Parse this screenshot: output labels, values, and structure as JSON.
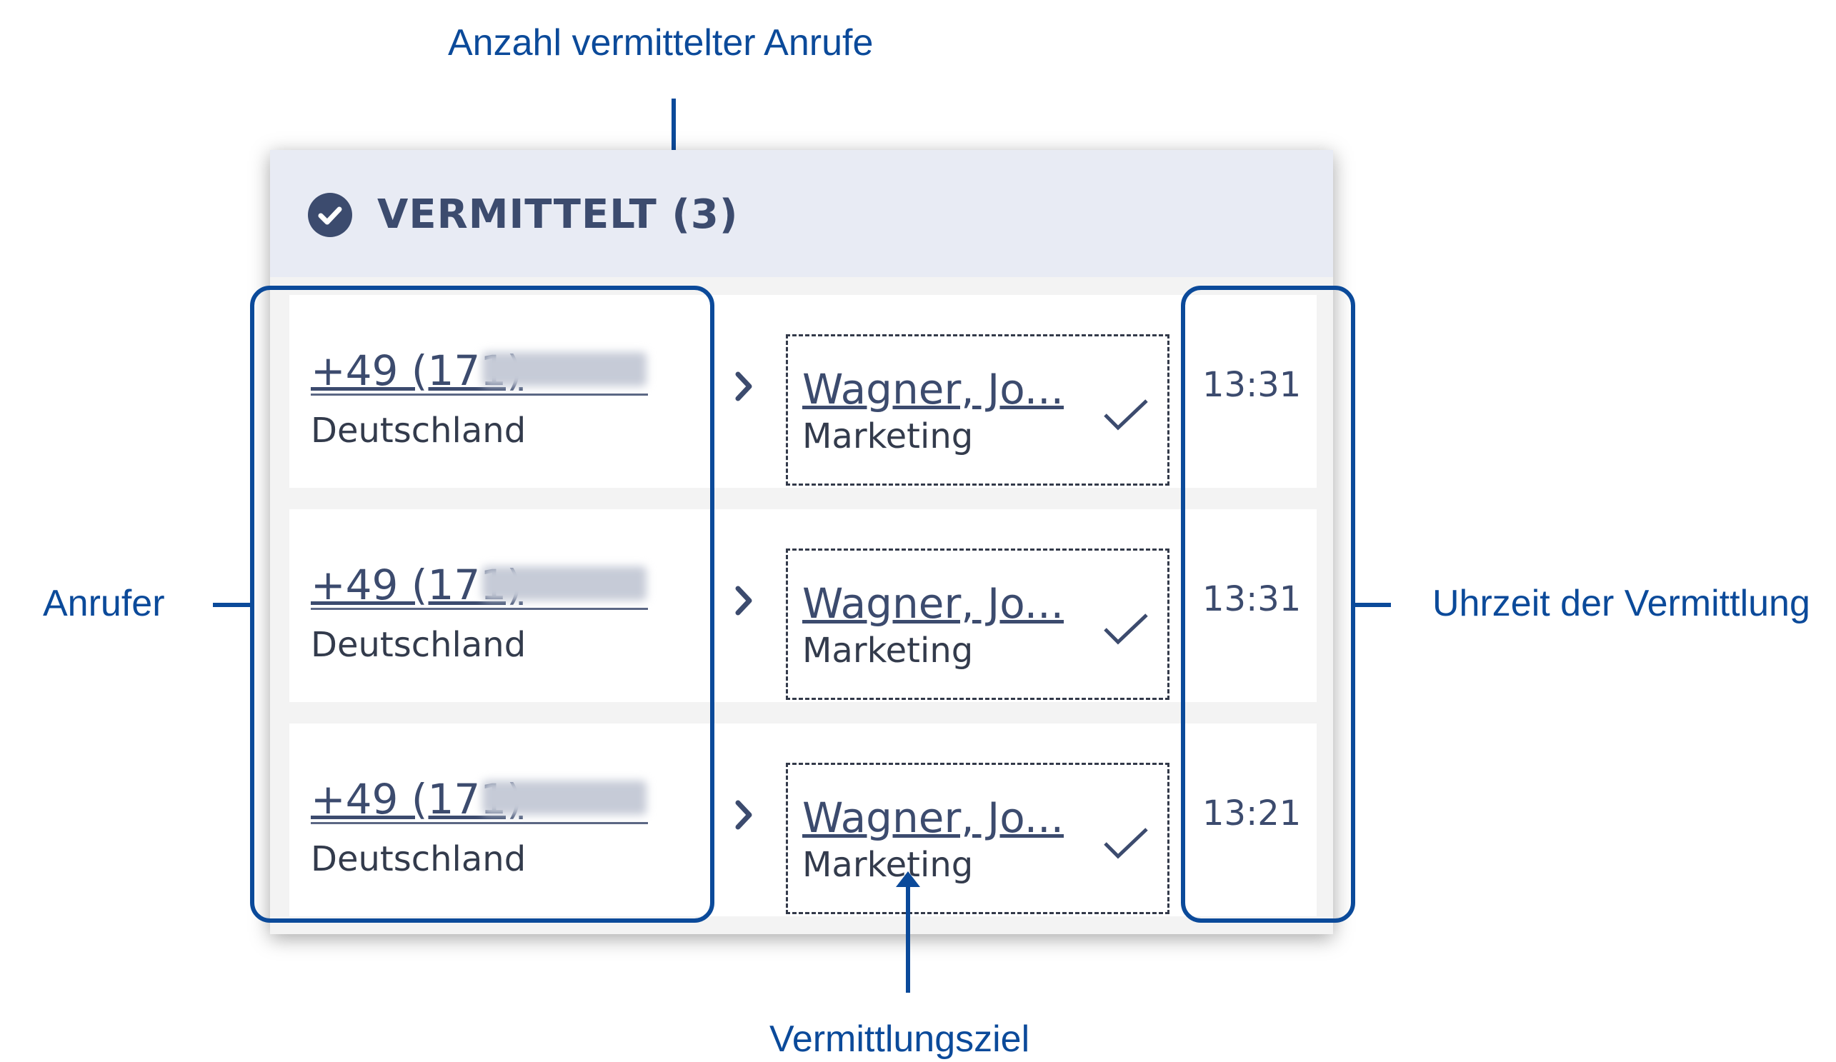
{
  "annotations": {
    "count_label": "Anzahl vermittelter Anrufe",
    "caller_label": "Anrufer",
    "time_label": "Uhrzeit der Vermittlung",
    "target_label": "Vermittlungsziel"
  },
  "panel": {
    "header": "VERMITTELT (3)",
    "header_icon": "check-circle-icon",
    "rows": [
      {
        "caller": "+49 (171)",
        "country": "Deutschland",
        "target": "Wagner, Jo...",
        "department": "Marketing",
        "time": "13:31"
      },
      {
        "caller": "+49 (171)",
        "country": "Deutschland",
        "target": "Wagner, Jo...",
        "department": "Marketing",
        "time": "13:31"
      },
      {
        "caller": "+49 (171)",
        "country": "Deutschland",
        "target": "Wagner, Jo...",
        "department": "Marketing",
        "time": "13:21"
      }
    ]
  },
  "colors": {
    "annotation": "#0b4a9a",
    "header_bg": "#e8ebf4",
    "text": "#3c4b6e"
  }
}
